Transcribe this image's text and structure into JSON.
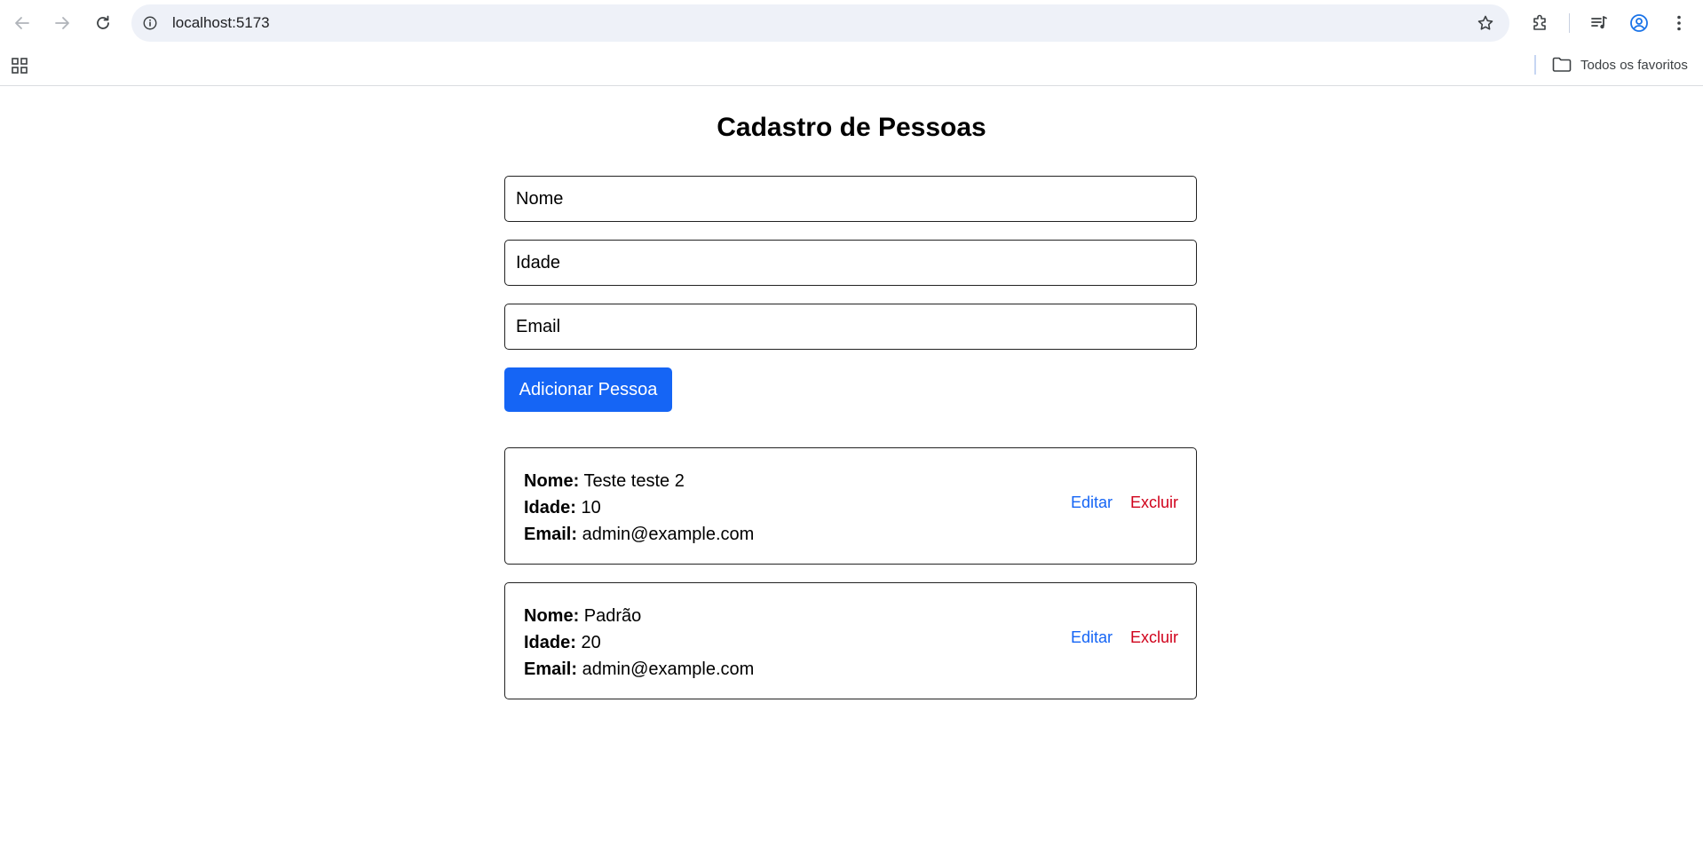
{
  "browser": {
    "url": "localhost:5173",
    "bookmarks_folder_label": "Todos os favoritos"
  },
  "page": {
    "title": "Cadastro de Pessoas",
    "form": {
      "name_placeholder": "Nome",
      "age_placeholder": "Idade",
      "email_placeholder": "Email",
      "submit_label": "Adicionar Pessoa"
    },
    "labels": {
      "name": "Nome:",
      "age": "Idade:",
      "email": "Email:"
    },
    "actions": {
      "edit": "Editar",
      "delete": "Excluir"
    },
    "people": [
      {
        "name": "Teste teste 2",
        "age": "10",
        "email": "admin@example.com"
      },
      {
        "name": "Padrão",
        "age": "20",
        "email": "admin@example.com"
      }
    ]
  },
  "colors": {
    "primary": "#1565f5",
    "danger": "#d0021b",
    "omnibox_bg": "#eef1f8"
  }
}
